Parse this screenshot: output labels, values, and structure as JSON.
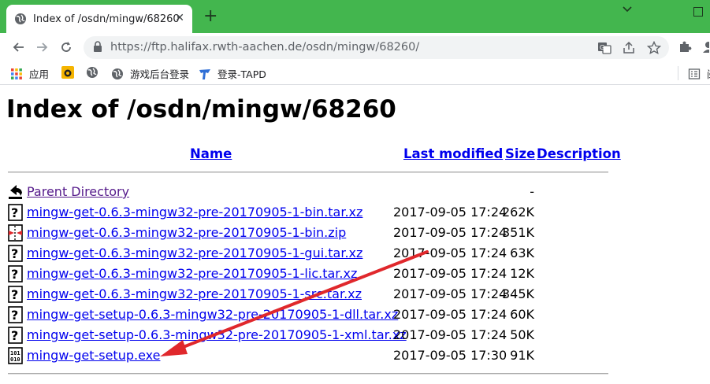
{
  "browser": {
    "tab_title": "Index of /osdn/mingw/68260",
    "url_host": "https://ftp.halifax.rwth-aachen.de",
    "url_path": "/osdn/mingw/68260/",
    "bookmarks": [
      {
        "label": "应用",
        "icon": "apps-grid-icon"
      },
      {
        "label": "",
        "icon": "bookmark-game-icon"
      },
      {
        "label": "",
        "icon": "globe-icon"
      },
      {
        "label": "游戏后台登录",
        "icon": "globe-icon"
      },
      {
        "label": "登录-TAPD",
        "icon": "tapd-icon"
      }
    ],
    "bookmark_overflow": "阅",
    "colors": {
      "frame": "#43b64e",
      "link": "#0000ee",
      "visited": "#551a8b",
      "annotation": "#e0282c"
    }
  },
  "page": {
    "title": "Index of /osdn/mingw/68260",
    "headers": {
      "name": "Name",
      "last_modified": "Last modified",
      "size": "Size",
      "description": "Description"
    },
    "parent": {
      "name": "Parent Directory",
      "size": "-",
      "icon": "back-arrow-icon"
    },
    "files": [
      {
        "name": "mingw-get-0.6.3-mingw32-pre-20170905-1-bin.tar.xz",
        "modified": "2017-09-05 17:24",
        "size": "262K",
        "icon": "unknown-file-icon"
      },
      {
        "name": "mingw-get-0.6.3-mingw32-pre-20170905-1-bin.zip",
        "modified": "2017-09-05 17:24",
        "size": "351K",
        "icon": "compressed-file-icon"
      },
      {
        "name": "mingw-get-0.6.3-mingw32-pre-20170905-1-gui.tar.xz",
        "modified": "2017-09-05 17:24",
        "size": "63K",
        "icon": "unknown-file-icon"
      },
      {
        "name": "mingw-get-0.6.3-mingw32-pre-20170905-1-lic.tar.xz",
        "modified": "2017-09-05 17:24",
        "size": "12K",
        "icon": "unknown-file-icon"
      },
      {
        "name": "mingw-get-0.6.3-mingw32-pre-20170905-1-src.tar.xz",
        "modified": "2017-09-05 17:24",
        "size": "345K",
        "icon": "unknown-file-icon"
      },
      {
        "name": "mingw-get-setup-0.6.3-mingw32-pre-20170905-1-dll.tar.xz",
        "modified": "2017-09-05 17:24",
        "size": "60K",
        "icon": "unknown-file-icon"
      },
      {
        "name": "mingw-get-setup-0.6.3-mingw32-pre-20170905-1-xml.tar.xz",
        "modified": "2017-09-05 17:24",
        "size": "50K",
        "icon": "unknown-file-icon"
      },
      {
        "name": "mingw-get-setup.exe",
        "modified": "2017-09-05 17:30",
        "size": "91K",
        "icon": "binary-file-icon"
      }
    ]
  }
}
